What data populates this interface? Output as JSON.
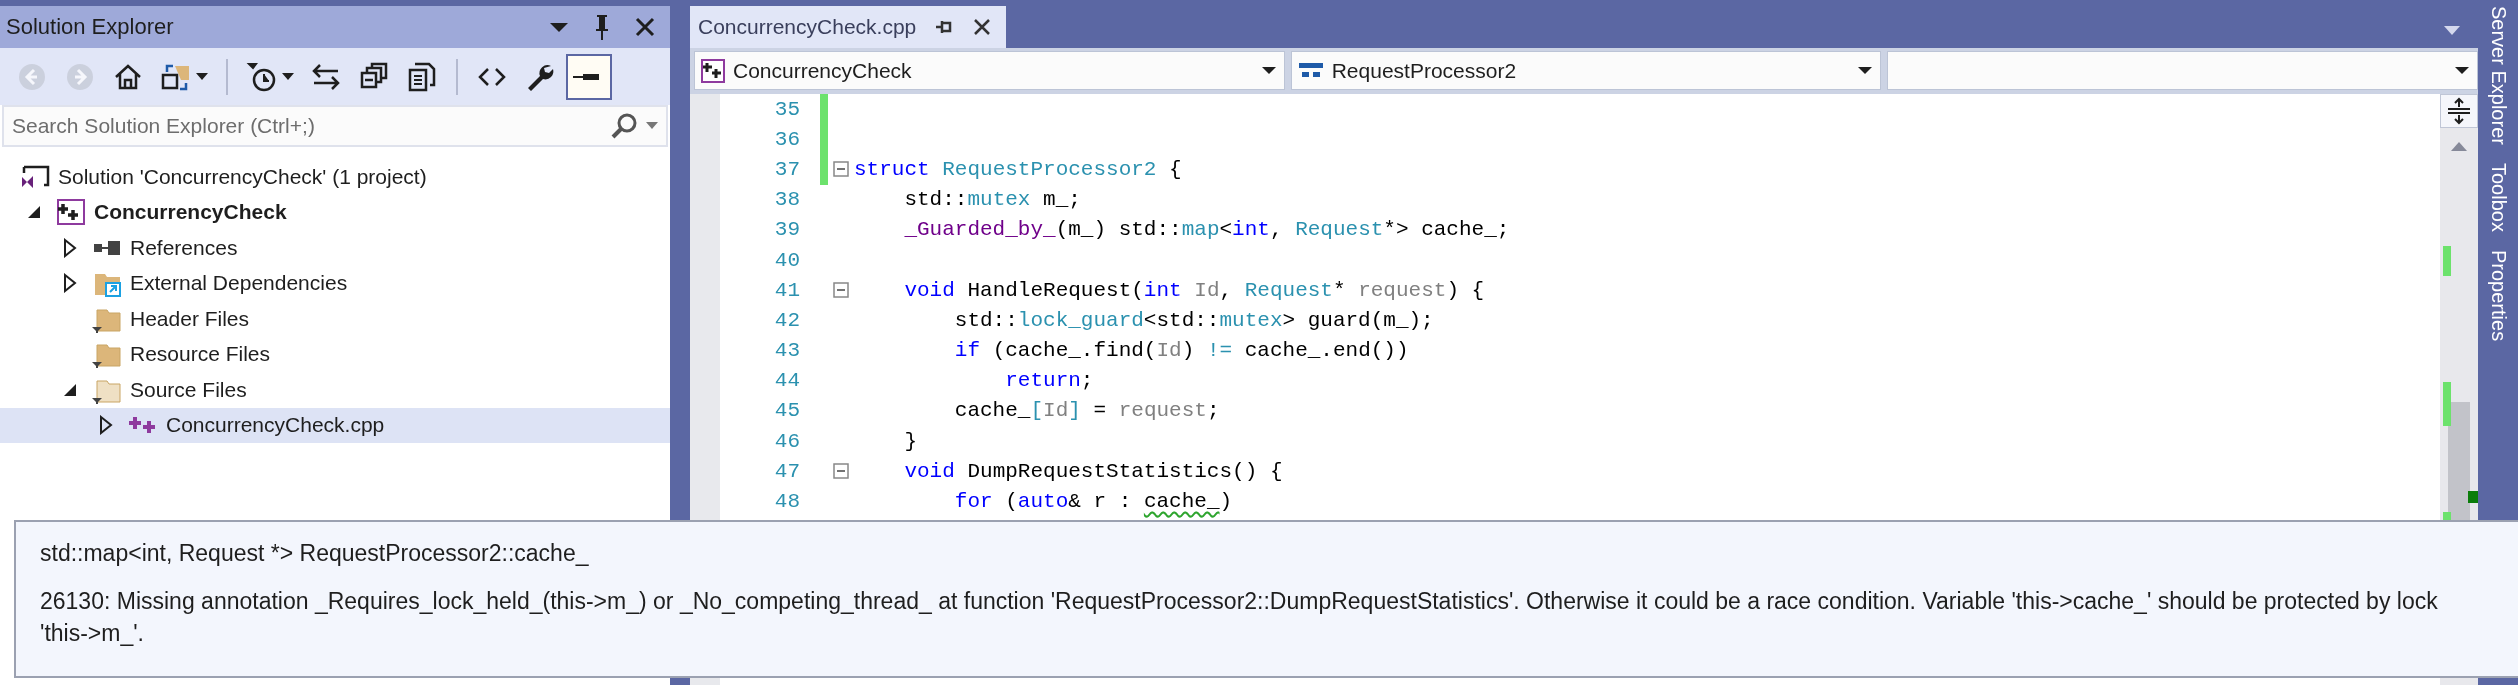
{
  "solution_explorer": {
    "title": "Solution Explorer",
    "toolbar": [
      [
        {
          "kind": "back",
          "disabled": true,
          "dropdown": false,
          "pressed": false
        },
        {
          "kind": "forward",
          "disabled": true,
          "dropdown": false,
          "pressed": false
        },
        {
          "kind": "home",
          "disabled": false,
          "dropdown": false,
          "pressed": false
        },
        {
          "kind": "sync",
          "disabled": false,
          "dropdown": true,
          "pressed": false
        }
      ],
      [
        {
          "kind": "history",
          "disabled": false,
          "dropdown": true,
          "pressed": false
        },
        {
          "kind": "swap",
          "disabled": false,
          "dropdown": false,
          "pressed": false
        },
        {
          "kind": "collapse",
          "disabled": false,
          "dropdown": false,
          "pressed": false
        },
        {
          "kind": "copy",
          "disabled": false,
          "dropdown": false,
          "pressed": false
        }
      ],
      [
        {
          "kind": "code",
          "disabled": false,
          "dropdown": false,
          "pressed": false
        },
        {
          "kind": "wrench",
          "disabled": false,
          "dropdown": false,
          "pressed": false
        },
        {
          "kind": "preview",
          "disabled": false,
          "dropdown": false,
          "pressed": true
        }
      ]
    ],
    "search": {
      "placeholder": "Search Solution Explorer (Ctrl+;)"
    },
    "tree": [
      {
        "label": "Solution 'ConcurrencyCheck' (1 project)",
        "kind": "solution",
        "selected": false,
        "children": [
          {
            "label": "ConcurrencyCheck",
            "kind": "project",
            "expanded": true,
            "selected": false,
            "children": [
              {
                "label": "References",
                "kind": "references",
                "expanded": false,
                "selected": false
              },
              {
                "label": "External Dependencies",
                "kind": "external",
                "expanded": false,
                "selected": false
              },
              {
                "label": "Header Files",
                "kind": "filter",
                "selected": false
              },
              {
                "label": "Resource Files",
                "kind": "filter",
                "selected": false
              },
              {
                "label": "Source Files",
                "kind": "filter-open",
                "expanded": true,
                "selected": false,
                "children": [
                  {
                    "label": "ConcurrencyCheck.cpp",
                    "kind": "cpp",
                    "expanded": false,
                    "selected": true
                  }
                ]
              }
            ]
          }
        ]
      }
    ]
  },
  "editor": {
    "tabs": [
      {
        "label": "ConcurrencyCheck.cpp",
        "selected": true
      }
    ],
    "dropdowns": [
      {
        "kind": "project",
        "text": "ConcurrencyCheck"
      },
      {
        "kind": "class",
        "text": "RequestProcessor2"
      },
      {
        "kind": "member"
      }
    ],
    "lines": [
      {
        "number": "35",
        "changed": true,
        "fold": false
      },
      {
        "number": "36",
        "changed": true,
        "fold": false
      },
      {
        "number": "37",
        "changed": true,
        "fold": true,
        "tokens": [
          {
            "text": "struct ",
            "kind": "keyword"
          },
          {
            "text": "RequestProcessor2",
            "kind": "type"
          },
          {
            "text": " {",
            "kind": "plain"
          }
        ]
      },
      {
        "number": "38",
        "changed": false,
        "fold": false,
        "tokens": [
          {
            "text": "    std::",
            "kind": "plain"
          },
          {
            "text": "mutex",
            "kind": "type"
          },
          {
            "text": " m_;",
            "kind": "plain"
          }
        ]
      },
      {
        "number": "39",
        "changed": false,
        "fold": false,
        "tokens": [
          {
            "text": "    _Guarded_by_",
            "kind": "macro"
          },
          {
            "text": "(m_) std::",
            "kind": "plain"
          },
          {
            "text": "map",
            "kind": "type"
          },
          {
            "text": "<",
            "kind": "plain"
          },
          {
            "text": "int",
            "kind": "keyword"
          },
          {
            "text": ", ",
            "kind": "plain"
          },
          {
            "text": "Request",
            "kind": "type"
          },
          {
            "text": "*> cache_;",
            "kind": "plain"
          }
        ]
      },
      {
        "number": "40",
        "changed": false,
        "fold": false
      },
      {
        "number": "41",
        "changed": false,
        "fold": true,
        "tokens": [
          {
            "text": "    void",
            "kind": "keyword"
          },
          {
            "text": " HandleRequest(",
            "kind": "plain"
          },
          {
            "text": "int ",
            "kind": "keyword"
          },
          {
            "text": "Id",
            "kind": "param"
          },
          {
            "text": ", ",
            "kind": "plain"
          },
          {
            "text": "Request",
            "kind": "type"
          },
          {
            "text": "* ",
            "kind": "plain"
          },
          {
            "text": "request",
            "kind": "param"
          },
          {
            "text": ") {",
            "kind": "plain"
          }
        ]
      },
      {
        "number": "42",
        "changed": false,
        "fold": false,
        "tokens": [
          {
            "text": "        std::",
            "kind": "plain"
          },
          {
            "text": "lock_guard",
            "kind": "type"
          },
          {
            "text": "<std::",
            "kind": "plain"
          },
          {
            "text": "mutex",
            "kind": "type"
          },
          {
            "text": "> guard(m_);",
            "kind": "plain"
          }
        ]
      },
      {
        "number": "43",
        "changed": false,
        "fold": false,
        "tokens": [
          {
            "text": "        if",
            "kind": "keyword"
          },
          {
            "text": " (cache_.find(",
            "kind": "plain"
          },
          {
            "text": "Id",
            "kind": "param"
          },
          {
            "text": ") ",
            "kind": "plain"
          },
          {
            "text": "!=",
            "kind": "type"
          },
          {
            "text": " cache_.end())",
            "kind": "plain"
          }
        ]
      },
      {
        "number": "44",
        "changed": false,
        "fold": false,
        "tokens": [
          {
            "text": "            return",
            "kind": "keyword"
          },
          {
            "text": ";",
            "kind": "plain"
          }
        ]
      },
      {
        "number": "45",
        "changed": false,
        "fold": false,
        "tokens": [
          {
            "text": "        cache_",
            "kind": "plain"
          },
          {
            "text": "[",
            "kind": "type"
          },
          {
            "text": "Id",
            "kind": "param"
          },
          {
            "text": "]",
            "kind": "type"
          },
          {
            "text": " = ",
            "kind": "plain"
          },
          {
            "text": "request",
            "kind": "param"
          },
          {
            "text": ";",
            "kind": "plain"
          }
        ]
      },
      {
        "number": "46",
        "changed": false,
        "fold": false,
        "tokens": [
          {
            "text": "    }",
            "kind": "plain"
          }
        ]
      },
      {
        "number": "47",
        "changed": false,
        "fold": true,
        "tokens": [
          {
            "text": "    void",
            "kind": "keyword"
          },
          {
            "text": " DumpRequestStatistics() {",
            "kind": "plain"
          }
        ]
      },
      {
        "number": "48",
        "changed": false,
        "fold": false,
        "tokens": [
          {
            "text": "        for",
            "kind": "keyword"
          },
          {
            "text": " (",
            "kind": "plain"
          },
          {
            "text": "auto",
            "kind": "keyword"
          },
          {
            "text": "& r : ",
            "kind": "plain"
          },
          {
            "text": "cache_",
            "kind": "flagged"
          },
          {
            "text": ")",
            "kind": "plain"
          }
        ]
      }
    ]
  },
  "side_tabs": [
    "Server Explorer",
    "Toolbox",
    "Properties"
  ],
  "tooltip": {
    "signature": "std::map<int, Request *> RequestProcessor2::cache_",
    "message_lines": [
      "26130: Missing annotation _Requires_lock_held_(this->m_) or _No_competing_thread_ at function 'RequestProcessor2::DumpRequestStatistics'. Otherwise it could be a race condition. Variable 'this->cache_' should be protected by lock",
      "'this->m_'."
    ]
  }
}
